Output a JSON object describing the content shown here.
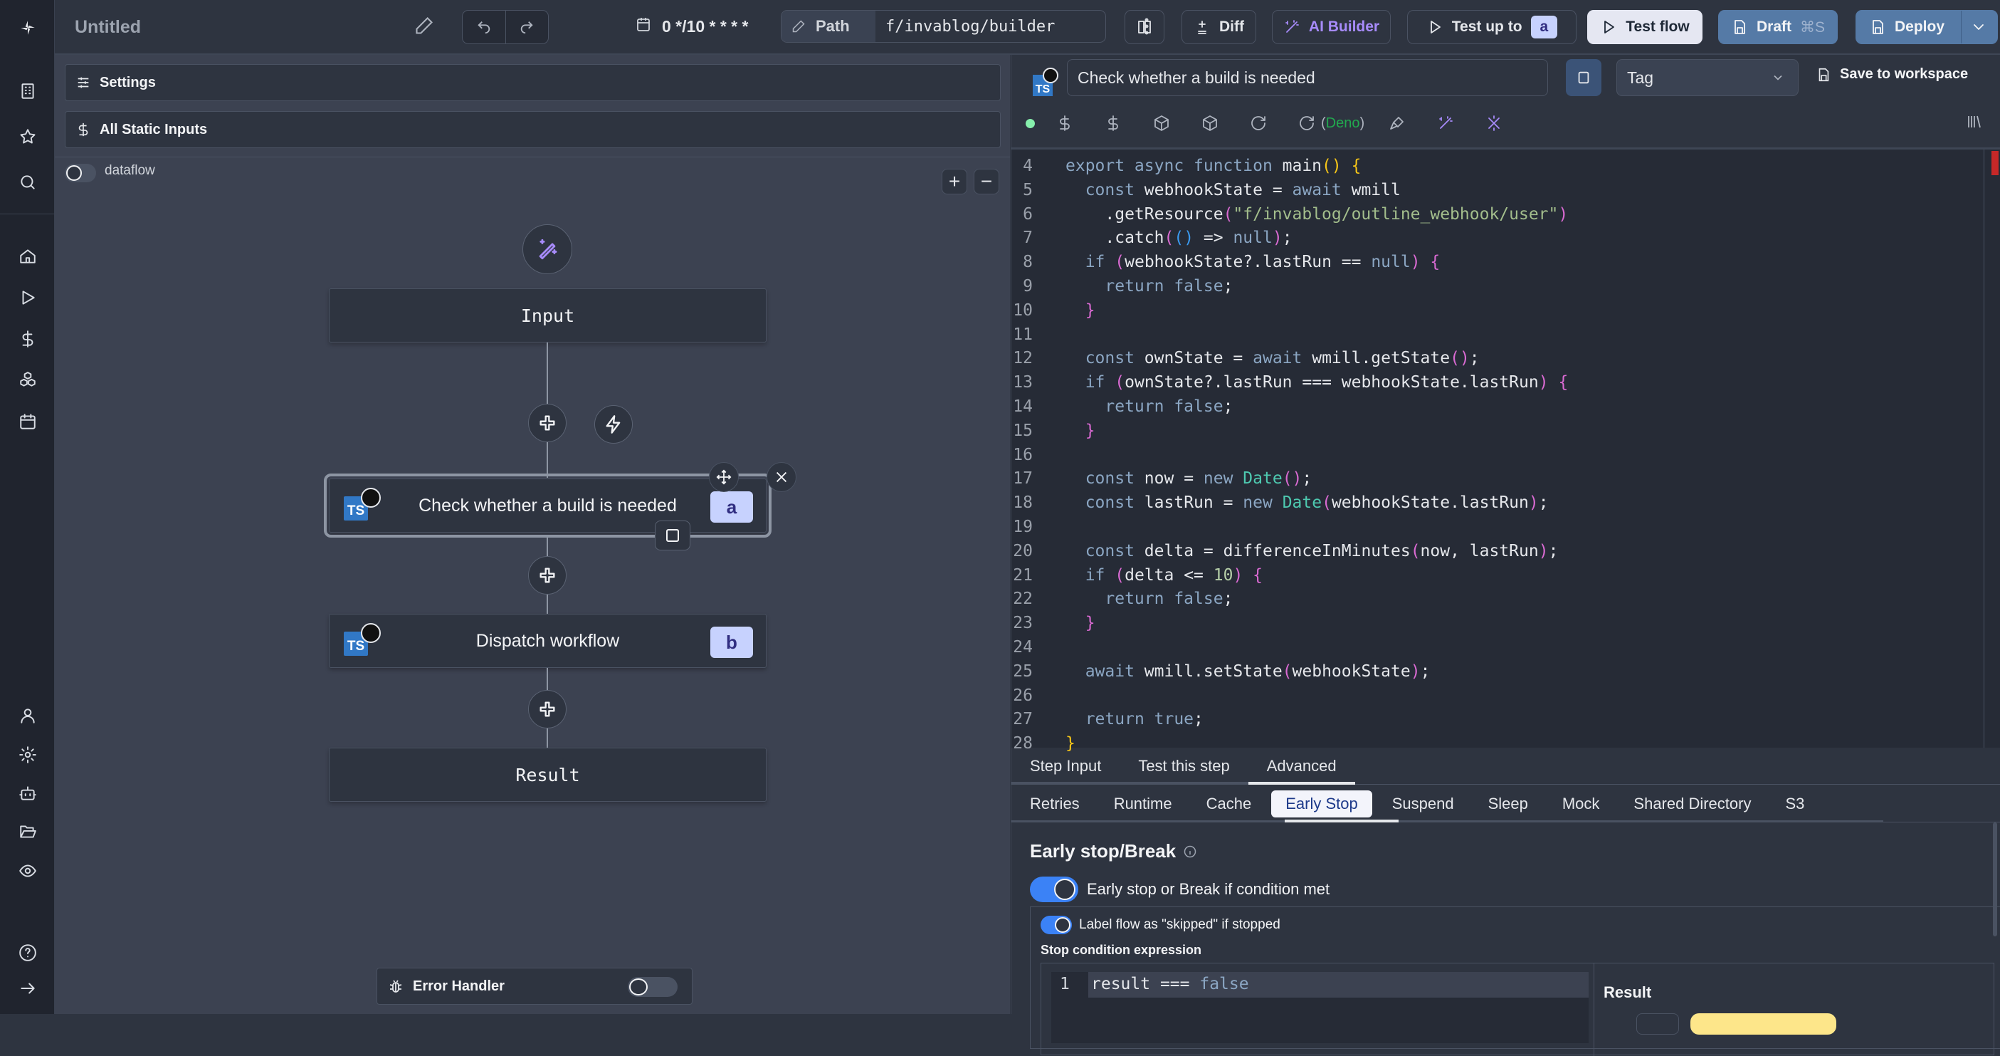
{
  "app": {
    "title": "Untitled",
    "schedule": "0 */10 * * * *",
    "path_label": "Path",
    "path_value": "f/invablog/builder"
  },
  "toolbar": {
    "diff_label": "Diff",
    "ai_builder_label": "AI Builder",
    "test_up_to_label": "Test up to",
    "test_up_to_step": "a",
    "test_flow_label": "Test flow",
    "draft_label": "Draft",
    "draft_shortcut": "⌘S",
    "deploy_label": "Deploy"
  },
  "sidebar": {
    "top_icons": [
      "building-icon",
      "star-icon",
      "search-icon"
    ],
    "nav_icons": [
      "home-icon",
      "play-icon",
      "dollar-icon",
      "boxes-icon",
      "calendar-icon"
    ],
    "bottom_icons": [
      "user-icon",
      "gear-icon",
      "bot-icon",
      "folder-open-icon",
      "eye-icon"
    ],
    "footer_icons": [
      "help-icon",
      "expand-arrow-icon"
    ]
  },
  "flow": {
    "settings_label": "Settings",
    "static_inputs_label": "All Static Inputs",
    "dataflow_label": "dataflow",
    "dataflow_on": false,
    "zoom_in": "+",
    "zoom_out": "−",
    "input_node": "Input",
    "steps": [
      {
        "id": "a",
        "label": "Check whether a build is needed",
        "selected": true
      },
      {
        "id": "b",
        "label": "Dispatch workflow",
        "selected": false
      }
    ],
    "result_node": "Result",
    "error_handler_label": "Error Handler",
    "error_handler_on": false
  },
  "editor": {
    "language_badge": "TS",
    "summary_value": "Check whether a build is needed",
    "tag_placeholder": "Tag",
    "save_to_workspace_label": "Save to workspace",
    "runtime_label": "Deno",
    "code_lines": [
      {
        "n": 4,
        "html": "<span class='kw'>export async function</span> main<span class='brace'>()</span> <span class='brace'>{</span>"
      },
      {
        "n": 5,
        "html": "  <span class='kw'>const</span> webhookState = <span class='kw'>await</span> wmill"
      },
      {
        "n": 6,
        "html": "    .getResource<span class='par'>(</span><span class='str'>\"f/invablog/outline_webhook/user\"</span><span class='par'>)</span>"
      },
      {
        "n": 7,
        "html": "    .catch<span class='par'>(</span><span class='par2'>()</span> => <span class='kw'>null</span><span class='par'>)</span>;"
      },
      {
        "n": 8,
        "html": "  <span class='kw'>if</span> <span class='par'>(</span>webhookState?.lastRun == <span class='kw'>null</span><span class='par'>)</span> <span class='par'>{</span>"
      },
      {
        "n": 9,
        "html": "    <span class='kw'>return false</span>;"
      },
      {
        "n": 10,
        "html": "  <span class='par'>}</span>"
      },
      {
        "n": 11,
        "html": ""
      },
      {
        "n": 12,
        "html": "  <span class='kw'>const</span> ownState = <span class='kw'>await</span> wmill.getState<span class='par'>()</span>;"
      },
      {
        "n": 13,
        "html": "  <span class='kw'>if</span> <span class='par'>(</span>ownState?.lastRun === webhookState.lastRun<span class='par'>)</span> <span class='par'>{</span>"
      },
      {
        "n": 14,
        "html": "    <span class='kw'>return false</span>;"
      },
      {
        "n": 15,
        "html": "  <span class='par'>}</span>"
      },
      {
        "n": 16,
        "html": ""
      },
      {
        "n": 17,
        "html": "  <span class='kw'>const</span> now = <span class='kw'>new</span> <span class='cls'>Date</span><span class='par'>()</span>;"
      },
      {
        "n": 18,
        "html": "  <span class='kw'>const</span> lastRun = <span class='kw'>new</span> <span class='cls'>Date</span><span class='par'>(</span>webhookState.lastRun<span class='par'>)</span>;"
      },
      {
        "n": 19,
        "html": ""
      },
      {
        "n": 20,
        "html": "  <span class='kw'>const</span> delta = differenceInMinutes<span class='par'>(</span>now, lastRun<span class='par'>)</span>;"
      },
      {
        "n": 21,
        "html": "  <span class='kw'>if</span> <span class='par'>(</span>delta <= <span class='num'>10</span><span class='par'>)</span> <span class='par'>{</span>"
      },
      {
        "n": 22,
        "html": "    <span class='kw'>return false</span>;"
      },
      {
        "n": 23,
        "html": "  <span class='par'>}</span>"
      },
      {
        "n": 24,
        "html": ""
      },
      {
        "n": 25,
        "html": "  <span class='kw'>await</span> wmill.setState<span class='par'>(</span>webhookState<span class='par'>)</span>;"
      },
      {
        "n": 26,
        "html": ""
      },
      {
        "n": 27,
        "html": "  <span class='kw'>return true</span>;"
      },
      {
        "n": 28,
        "html": "<span class='brace'>}</span>"
      }
    ]
  },
  "bottom_tabs": {
    "primary": [
      {
        "label": "Step Input",
        "active": false
      },
      {
        "label": "Test this step",
        "active": false
      },
      {
        "label": "Advanced",
        "active": true
      }
    ],
    "secondary": [
      {
        "label": "Retries",
        "active": false
      },
      {
        "label": "Runtime",
        "active": false
      },
      {
        "label": "Cache",
        "active": false
      },
      {
        "label": "Early Stop",
        "active": true
      },
      {
        "label": "Suspend",
        "active": false
      },
      {
        "label": "Sleep",
        "active": false
      },
      {
        "label": "Mock",
        "active": false
      },
      {
        "label": "Shared Directory",
        "active": false
      },
      {
        "label": "S3",
        "active": false
      }
    ]
  },
  "early_stop": {
    "heading": "Early stop/Break",
    "toggle_label": "Early stop or Break if condition met",
    "toggle_on": true,
    "skipped_label": "Label flow as \"skipped\" if stopped",
    "skipped_on": true,
    "condition_label": "Stop condition expression",
    "expr_line_no": "1",
    "expr_result": "result",
    "expr_op": " === ",
    "expr_value": "false",
    "result_label": "Result"
  },
  "colors": {
    "accent_blue": "#3b82f6",
    "deploy_blue": "#557aa6",
    "ai_purple": "#a78bfa",
    "step_badge": "#c7d2fe",
    "deno_green": "#22a94f"
  }
}
